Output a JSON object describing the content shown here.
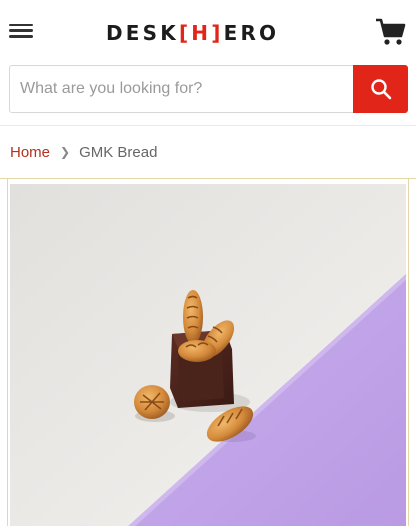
{
  "header": {
    "logo_left": "DESK",
    "logo_mid": "[H]",
    "logo_right": "ERO",
    "menu_icon": "hamburger-menu-icon",
    "cart_icon": "shopping-cart-icon"
  },
  "search": {
    "placeholder": "What are you looking for?",
    "icon": "search-icon"
  },
  "breadcrumb": {
    "home": "Home",
    "separator_icon": "chevron-right-icon",
    "current": "GMK Bread"
  },
  "product": {
    "image_alt": "GMK Bread keycaps on white and lavender background"
  },
  "colors": {
    "brand_red": "#e12619",
    "link_red": "#b5301f",
    "lavender": "#c4a8ea",
    "keycap_brown": "#4a231b"
  }
}
